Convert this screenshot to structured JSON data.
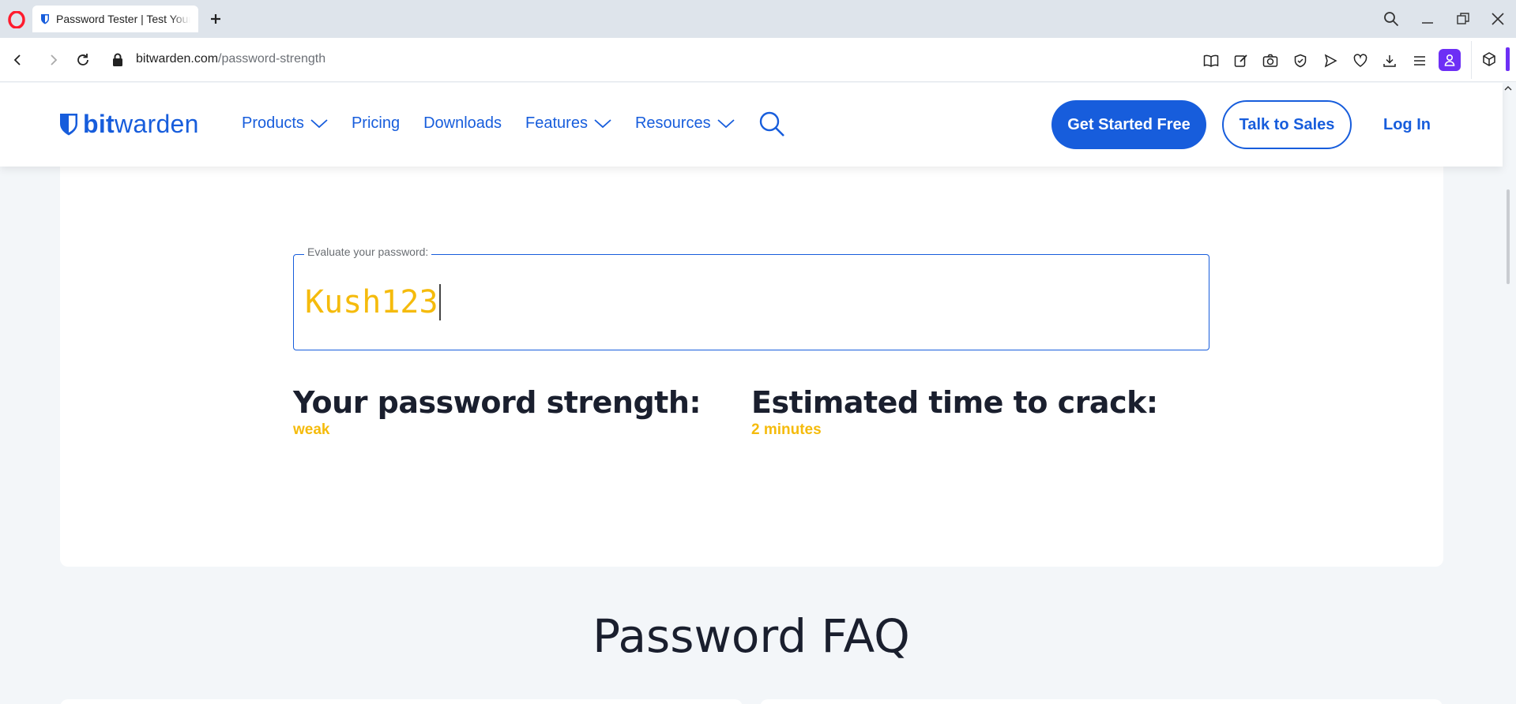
{
  "browser": {
    "tab_title": "Password Tester | Test Your",
    "url_domain": "bitwarden.com",
    "url_path": "/password-strength",
    "icons": [
      "opera-logo-icon",
      "new-tab-icon",
      "search-tabs-icon",
      "minimize-icon",
      "restore-icon",
      "close-icon",
      "back-icon",
      "forward-icon",
      "reload-icon",
      "lock-icon",
      "reader-icon",
      "edit-icon",
      "camera-icon",
      "shield-icon",
      "send-icon",
      "heart-icon",
      "download-icon",
      "menu-icon",
      "profile-icon",
      "box-icon"
    ],
    "accent_color": "#6d2ff5"
  },
  "site": {
    "brand_strong": "bit",
    "brand_light": "warden",
    "nav": {
      "products": "Products",
      "pricing": "Pricing",
      "downloads": "Downloads",
      "features": "Features",
      "resources": "Resources"
    },
    "cta_primary": "Get Started Free",
    "cta_secondary": "Talk to Sales",
    "login": "Log In",
    "brand_color": "#175ddc"
  },
  "tester": {
    "legend": "Evaluate your password:",
    "password_value": "Kush123",
    "strength_label": "Your password strength:",
    "strength_value": "weak",
    "crack_label": "Estimated time to crack:",
    "crack_value": "2 minutes",
    "value_color": "#f5bb0c"
  },
  "faq": {
    "title": "Password FAQ"
  }
}
